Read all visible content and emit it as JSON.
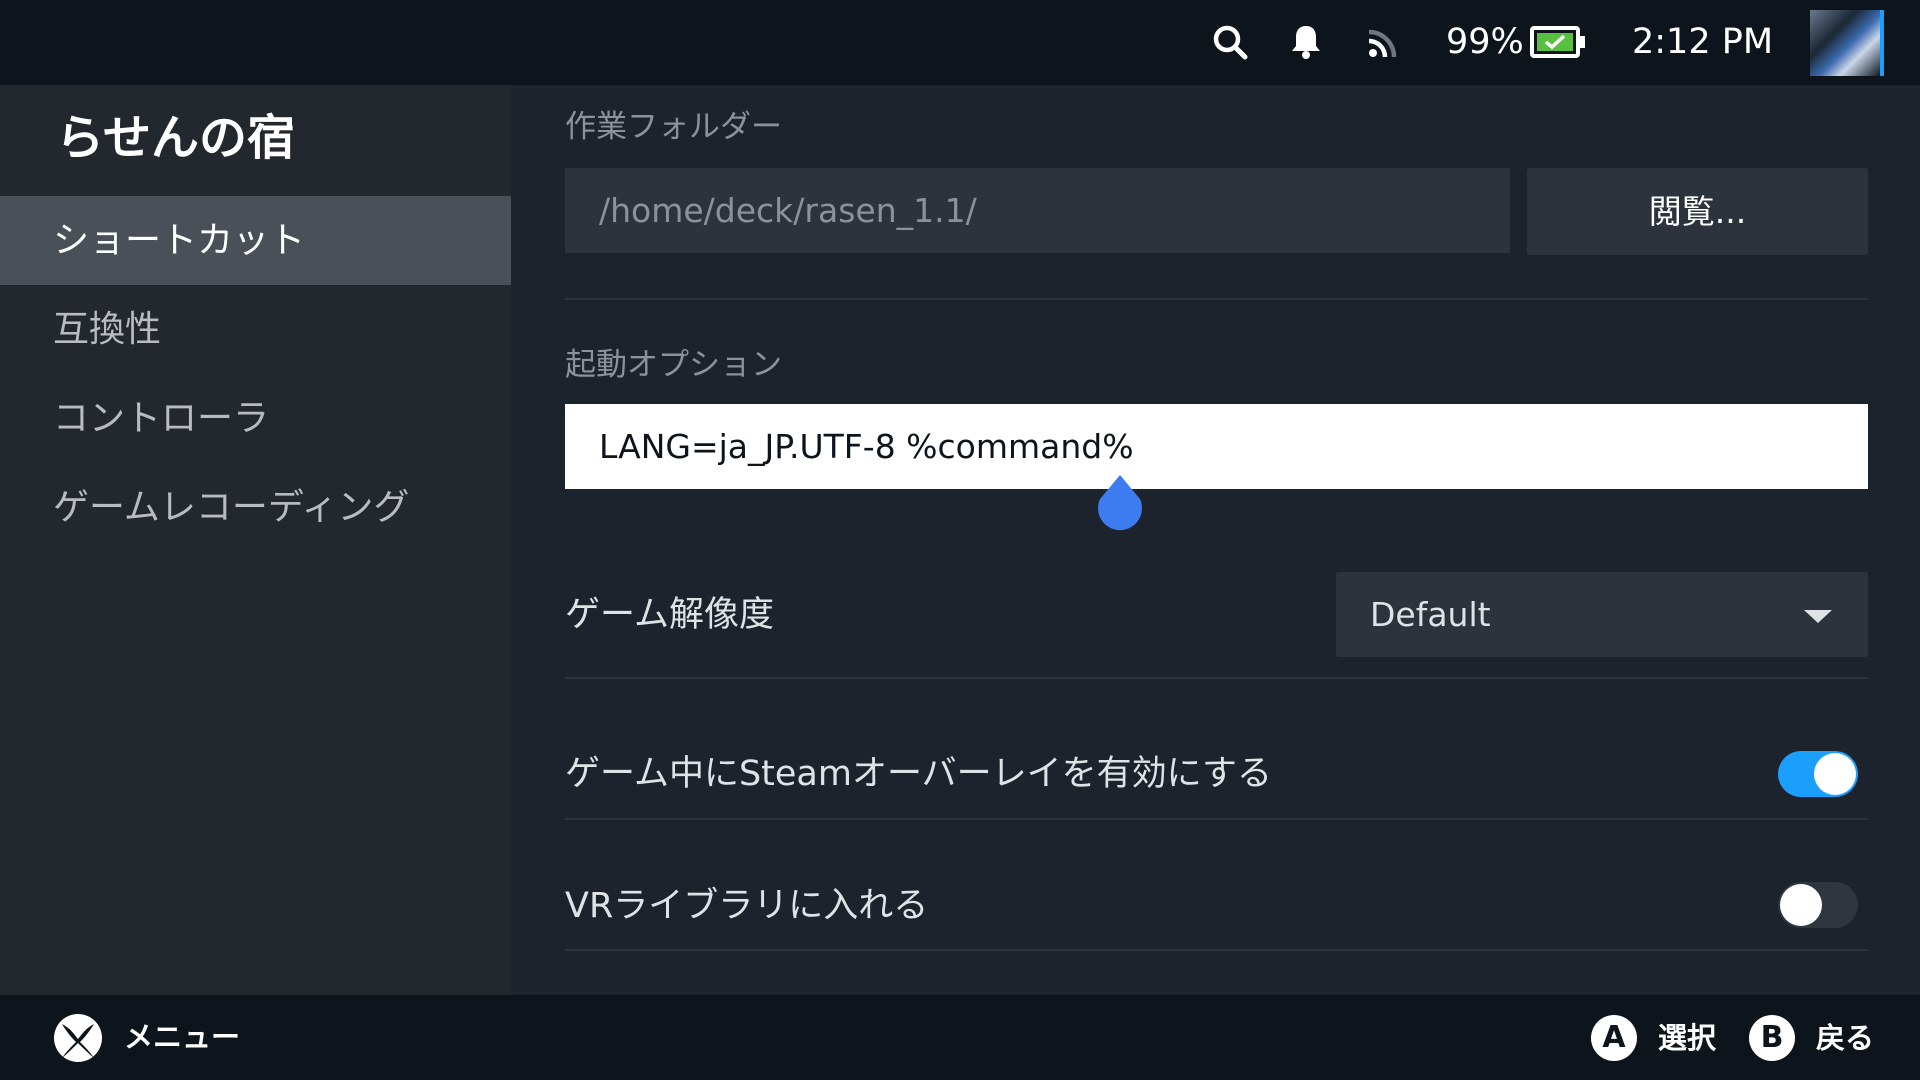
{
  "status_bar": {
    "battery_percent": "99%",
    "time": "2:12 PM",
    "icons": [
      "search-icon",
      "notification-bell-icon",
      "wifi-icon",
      "battery-icon",
      "avatar"
    ]
  },
  "sidebar": {
    "game_title": "らせんの宿",
    "items": [
      {
        "label": "ショートカット",
        "active": true
      },
      {
        "label": "互換性",
        "active": false
      },
      {
        "label": "コントローラ",
        "active": false
      },
      {
        "label": "ゲームレコーディング",
        "active": false
      }
    ]
  },
  "main": {
    "working_folder": {
      "label": "作業フォルダー",
      "value": "/home/deck/rasen_1.1/",
      "browse_label": "閲覧..."
    },
    "launch_options": {
      "label": "起動オプション",
      "value": "LANG=ja_JP.UTF-8 %command%"
    },
    "resolution": {
      "label": "ゲーム解像度",
      "selected": "Default"
    },
    "overlay_toggle": {
      "label": "ゲーム中にSteamオーバーレイを有効にする",
      "enabled": true
    },
    "vr_toggle": {
      "label": "VRライブラリに入れる",
      "enabled": false
    }
  },
  "bottom_bar": {
    "menu_label": "メニュー",
    "a_button": "A",
    "a_label": "選択",
    "b_button": "B",
    "b_label": "戻る"
  },
  "colors": {
    "accent": "#1a9fff",
    "battery_fill": "#59bf40",
    "cursor_handle": "#3d7bf0"
  }
}
